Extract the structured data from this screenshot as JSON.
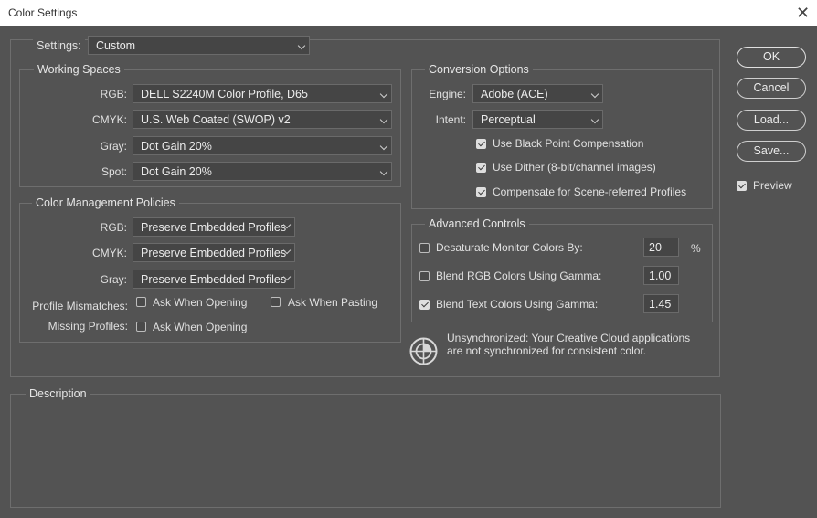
{
  "window": {
    "title": "Color Settings"
  },
  "settings": {
    "label": "Settings:",
    "value": "Custom"
  },
  "working_spaces": {
    "title": "Working Spaces",
    "rows": [
      {
        "label": "RGB:",
        "value": "DELL S2240M Color Profile, D65"
      },
      {
        "label": "CMYK:",
        "value": "U.S. Web Coated (SWOP) v2"
      },
      {
        "label": "Gray:",
        "value": "Dot Gain 20%"
      },
      {
        "label": "Spot:",
        "value": "Dot Gain 20%"
      }
    ]
  },
  "policies": {
    "title": "Color Management Policies",
    "rows": [
      {
        "label": "RGB:",
        "value": "Preserve Embedded Profiles"
      },
      {
        "label": "CMYK:",
        "value": "Preserve Embedded Profiles"
      },
      {
        "label": "Gray:",
        "value": "Preserve Embedded Profiles"
      }
    ],
    "mismatch_label": "Profile Mismatches:",
    "mismatch_opening": {
      "label": "Ask When Opening",
      "checked": false
    },
    "mismatch_pasting": {
      "label": "Ask When Pasting",
      "checked": false
    },
    "missing_label": "Missing Profiles:",
    "missing_opening": {
      "label": "Ask When Opening",
      "checked": false
    }
  },
  "conversion": {
    "title": "Conversion Options",
    "engine_label": "Engine:",
    "engine_value": "Adobe (ACE)",
    "intent_label": "Intent:",
    "intent_value": "Perceptual",
    "options": [
      {
        "label": "Use Black Point Compensation",
        "checked": true
      },
      {
        "label": "Use Dither (8-bit/channel images)",
        "checked": true
      },
      {
        "label": "Compensate for Scene-referred Profiles",
        "checked": true
      }
    ]
  },
  "advanced": {
    "title": "Advanced Controls",
    "desaturate": {
      "label": "Desaturate Monitor Colors By:",
      "value": "20",
      "unit": "%",
      "checked": false
    },
    "blend_rgb": {
      "label": "Blend RGB Colors Using Gamma:",
      "value": "1.00",
      "checked": false
    },
    "blend_text": {
      "label": "Blend Text Colors Using Gamma:",
      "value": "1.45",
      "checked": true
    }
  },
  "sync": {
    "line1": "Unsynchronized: Your Creative Cloud applications",
    "line2": "are not synchronized for consistent color."
  },
  "description": {
    "title": "Description"
  },
  "buttons": {
    "ok": "OK",
    "cancel": "Cancel",
    "load": "Load...",
    "save": "Save..."
  },
  "preview": {
    "label": "Preview",
    "checked": true
  },
  "colors": {
    "background": "#535353",
    "titlebar": "#ffffff",
    "border": "#6e6e6e"
  }
}
